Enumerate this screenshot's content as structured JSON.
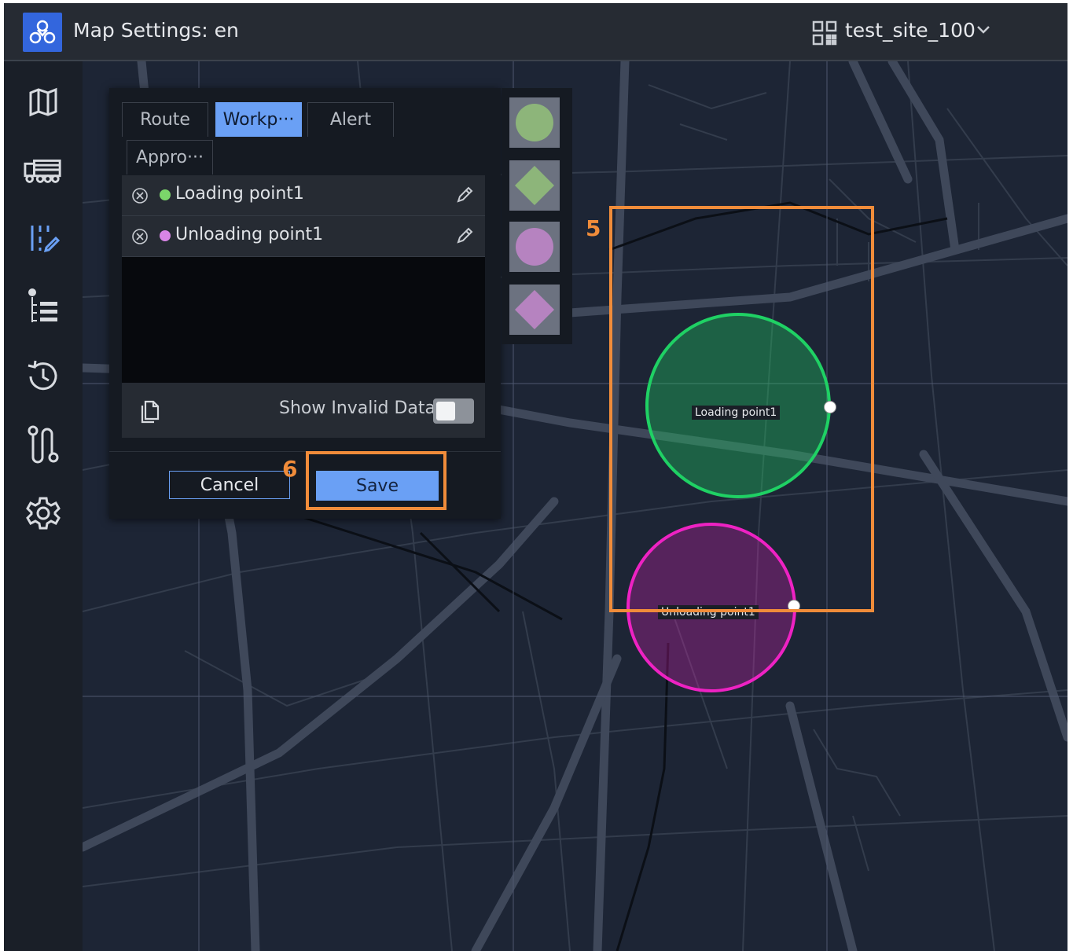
{
  "header": {
    "title": "Map Settings: en",
    "site": "test_site_100"
  },
  "sidebar": {
    "items": [
      {
        "icon": "map-icon"
      },
      {
        "icon": "vehicle-icon"
      },
      {
        "icon": "map-edit-icon",
        "active": true
      },
      {
        "icon": "list-icon"
      },
      {
        "icon": "history-icon"
      },
      {
        "icon": "route-icon"
      },
      {
        "icon": "gear-icon"
      }
    ]
  },
  "panel": {
    "tabs": [
      "Route",
      "Workp···",
      "Alert",
      "Appro···"
    ],
    "active_tab": "Workp···",
    "items": [
      {
        "label": "Loading point1",
        "color": "#7bd66a"
      },
      {
        "label": "Unloading point1",
        "color": "#d885e6"
      }
    ],
    "show_invalid_label": "Show Invalid Data",
    "show_invalid": false,
    "cancel_label": "Cancel",
    "save_label": "Save"
  },
  "shape_palette": [
    {
      "shape": "circle",
      "color": "#8db57a"
    },
    {
      "shape": "diamond",
      "color": "#8db57a"
    },
    {
      "shape": "circle",
      "color": "#b683c0"
    },
    {
      "shape": "diamond",
      "color": "#b683c0"
    }
  ],
  "map": {
    "labels": [
      "Loading point1",
      "Unloading point1"
    ],
    "loading_zone_color": "#1fd164",
    "unloading_zone_color": "#ee22c3"
  },
  "callouts": [
    "5",
    "6"
  ],
  "colors": {
    "accent": "#6aa0f5",
    "callout": "#f08c3a",
    "map_bg": "#1d2535"
  }
}
